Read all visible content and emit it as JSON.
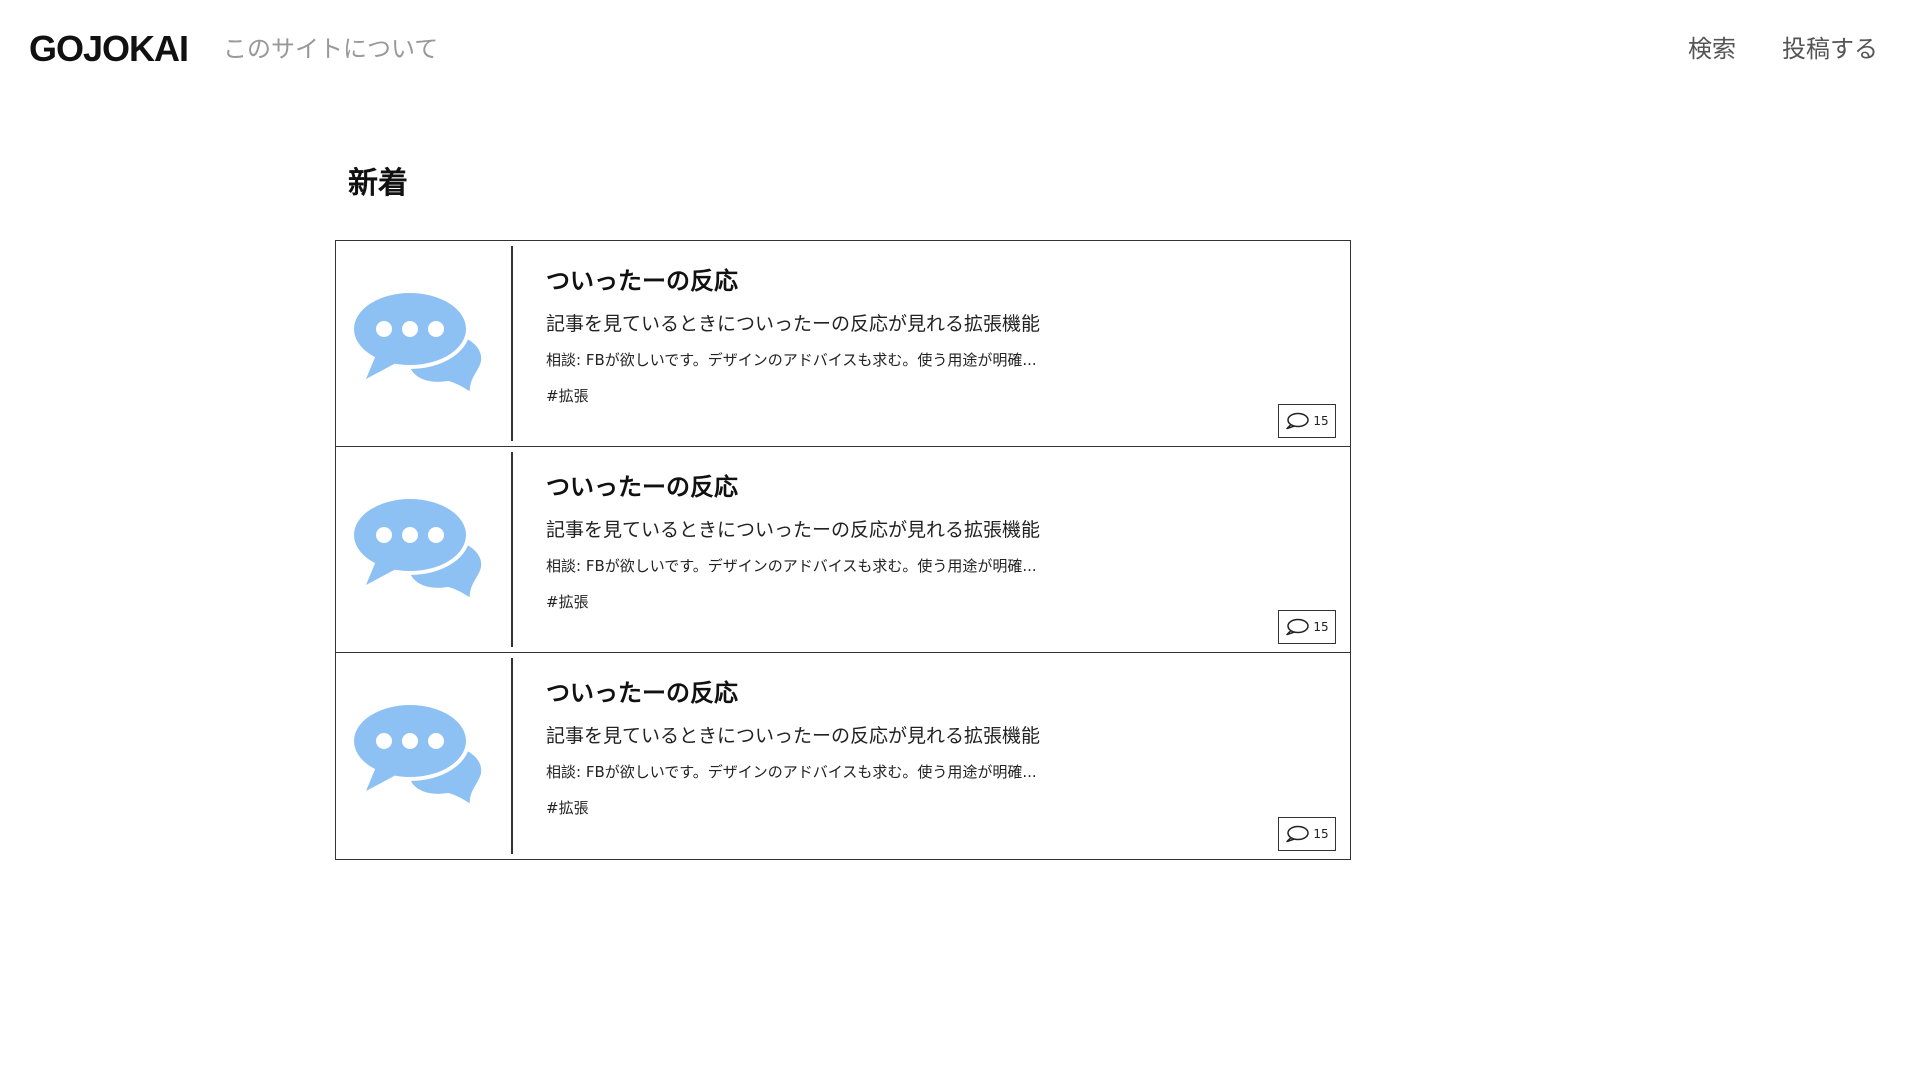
{
  "header": {
    "logo": "GOJOKAI",
    "about_link": "このサイトについて",
    "nav": [
      {
        "label": "検索"
      },
      {
        "label": "投稿する"
      }
    ]
  },
  "section": {
    "title": "新着"
  },
  "colors": {
    "accent_icon": "#8EC1F3"
  },
  "posts": [
    {
      "thumbnail_icon": "speech-bubbles-icon",
      "title": "ついったーの反応",
      "description": "記事を見ているときについったーの反応が見れる拡張機能",
      "note": "相談: FBが欲しいです。デザインのアドバイスも求む。使う用途が明確...",
      "tag": "#拡張",
      "comment_count": "15"
    },
    {
      "thumbnail_icon": "speech-bubbles-icon",
      "title": "ついったーの反応",
      "description": "記事を見ているときについったーの反応が見れる拡張機能",
      "note": "相談: FBが欲しいです。デザインのアドバイスも求む。使う用途が明確...",
      "tag": "#拡張",
      "comment_count": "15"
    },
    {
      "thumbnail_icon": "speech-bubbles-icon",
      "title": "ついったーの反応",
      "description": "記事を見ているときについったーの反応が見れる拡張機能",
      "note": "相談: FBが欲しいです。デザインのアドバイスも求む。使う用途が明確...",
      "tag": "#拡張",
      "comment_count": "15"
    }
  ]
}
